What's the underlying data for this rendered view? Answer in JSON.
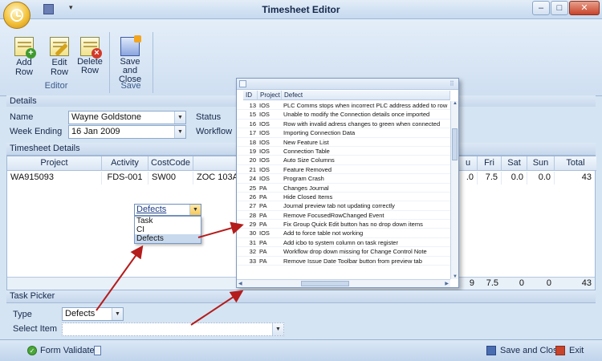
{
  "window": {
    "title": "Timesheet Editor",
    "min": "–",
    "max": "□",
    "close": "✕",
    "qat_dropdown": "▾"
  },
  "ribbon": {
    "groups": [
      {
        "label": "Editor",
        "buttons": [
          {
            "label": "Add Row",
            "icon": "add-row-icon"
          },
          {
            "label": "Edit Row",
            "icon": "edit-row-icon"
          },
          {
            "label": "Delete Row",
            "icon": "delete-row-icon"
          }
        ]
      },
      {
        "label": "Save",
        "buttons": [
          {
            "label": "Save and Close",
            "icon": "save-close-icon"
          }
        ]
      }
    ]
  },
  "details": {
    "header": "Details",
    "name_label": "Name",
    "name_value": "Wayne Goldstone",
    "week_label": "Week Ending",
    "week_value": "16 Jan 2009",
    "status_label": "Status",
    "workflow_label": "Workflow"
  },
  "timesheet": {
    "header": "Timesheet Details",
    "columns": {
      "project": "Project",
      "activity": "Activity",
      "costcode": "CostCode",
      "fri": "Fri",
      "sat": "Sat",
      "sun": "Sun",
      "total": "Total"
    },
    "row": {
      "project": "WA915093",
      "activity": "FDS-001",
      "costcode": "SW00",
      "desc": "ZOC 103A Co",
      "thu": ".0",
      "fri": "7.5",
      "sat": "0.0",
      "sun": "0.0",
      "total": "43"
    },
    "footer": {
      "thu": "9",
      "fri": "7.5",
      "sat": "0",
      "sun": "0",
      "total": "43"
    },
    "cell_editor": {
      "value": "Defects",
      "options": [
        "Task",
        "CI",
        "Defects"
      ],
      "selected": 2
    }
  },
  "defect_popup": {
    "columns": {
      "id": "ID",
      "project": "Project",
      "defect": "Defect"
    },
    "rows": [
      {
        "id": "13",
        "project": "IOS",
        "defect": "PLC Comms stops when incorrect PLC address added to row"
      },
      {
        "id": "15",
        "project": "IOS",
        "defect": "Unable to modify the Connection details once imported"
      },
      {
        "id": "16",
        "project": "IOS",
        "defect": "Row with invalid adress changes to green when connected"
      },
      {
        "id": "17",
        "project": "IOS",
        "defect": "Importing Connection  Data"
      },
      {
        "id": "18",
        "project": "IOS",
        "defect": "New Feature List"
      },
      {
        "id": "19",
        "project": "IOS",
        "defect": "Connection Table"
      },
      {
        "id": "20",
        "project": "IOS",
        "defect": "Auto Size Columns"
      },
      {
        "id": "21",
        "project": "IOS",
        "defect": "Feature Removed"
      },
      {
        "id": "24",
        "project": "IOS",
        "defect": "Program Crash"
      },
      {
        "id": "25",
        "project": "PA",
        "defect": "Changes Journal"
      },
      {
        "id": "26",
        "project": "PA",
        "defect": "Hide Closed Items"
      },
      {
        "id": "27",
        "project": "PA",
        "defect": "Journal preview tab not updating correctly"
      },
      {
        "id": "28",
        "project": "PA",
        "defect": "Remove FocusedRowChanged Event"
      },
      {
        "id": "29",
        "project": "PA",
        "defect": "Fix Group Quick Edit button has no drop down items"
      },
      {
        "id": "30",
        "project": "IOS",
        "defect": "Add to force table not working"
      },
      {
        "id": "31",
        "project": "PA",
        "defect": "Add icbo to system column on task register"
      },
      {
        "id": "32",
        "project": "PA",
        "defect": "Workflow drop down missing for Change Control Note"
      },
      {
        "id": "33",
        "project": "PA",
        "defect": "Remove Issue Date Toolbar button from preview tab"
      }
    ]
  },
  "task_picker": {
    "header": "Task Picker",
    "type_label": "Type",
    "type_value": "Defects",
    "item_label": "Select Item",
    "item_value": ""
  },
  "statusbar": {
    "validated": "Form Validated",
    "save_close": "Save and Close",
    "exit": "Exit"
  }
}
